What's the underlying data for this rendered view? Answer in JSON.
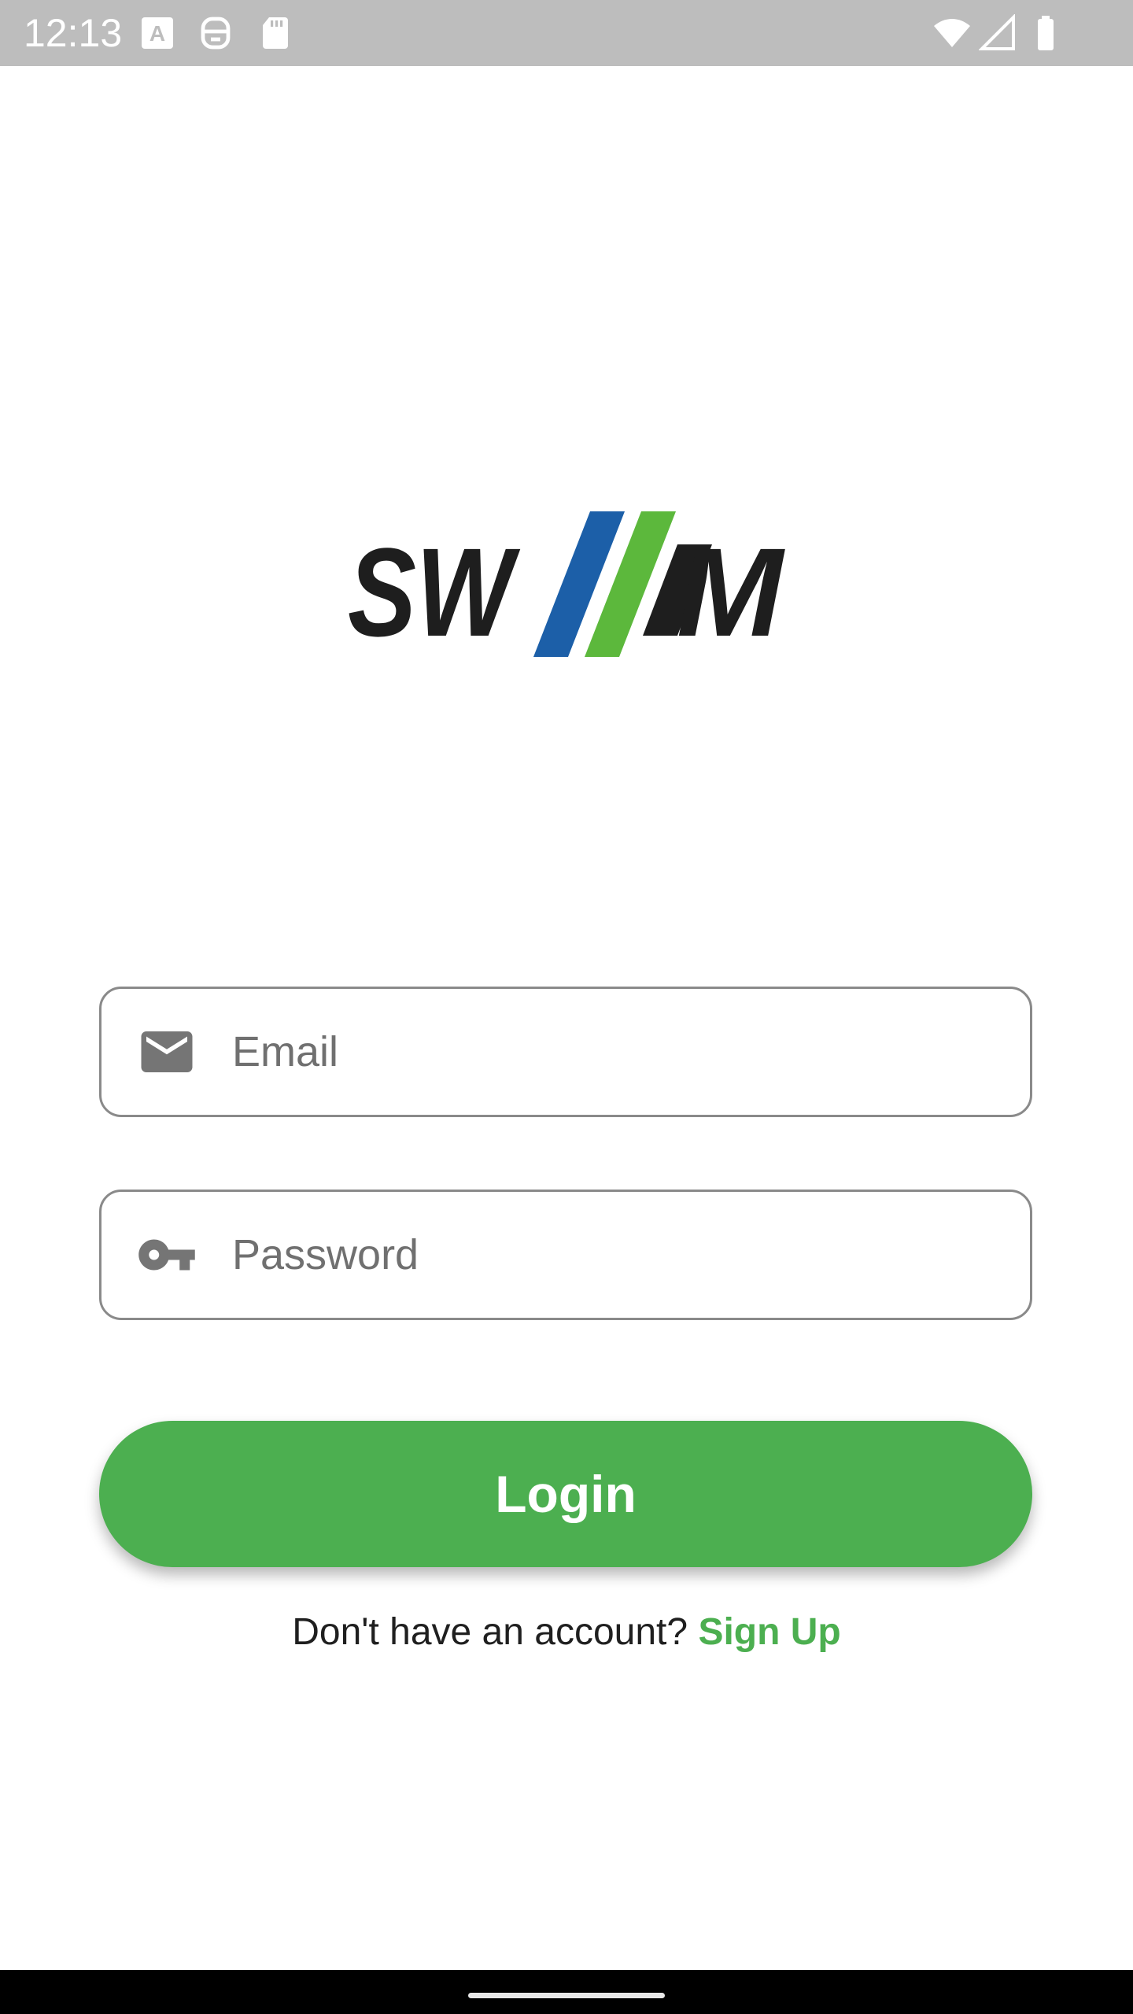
{
  "status_bar": {
    "time": "12:13",
    "icons": [
      "font-a-icon",
      "robot-face-icon",
      "sd-card-icon",
      "wifi-icon",
      "cell-signal-icon",
      "battery-icon"
    ]
  },
  "logo": {
    "text": "SWM",
    "colors": {
      "text": "#1e1e1e",
      "blue_stripe": "#1c5fa8",
      "green_stripe": "#5cb83c"
    }
  },
  "login_form": {
    "email": {
      "placeholder": "Email",
      "value": "",
      "icon": "email-icon"
    },
    "password": {
      "placeholder": "Password",
      "value": "",
      "icon": "key-icon"
    },
    "login_label": "Login"
  },
  "signup": {
    "prompt": "Don't have an account?",
    "link_label": "Sign Up"
  },
  "colors": {
    "accent": "#4caf50",
    "status_bar": "#bdbdbd",
    "field_border": "#8a8a8a"
  }
}
